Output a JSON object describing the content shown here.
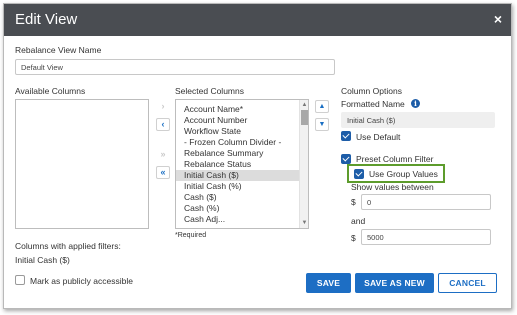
{
  "dialog": {
    "title": "Edit View",
    "close_glyph": "×"
  },
  "rebalance_view_name": {
    "label": "Rebalance View Name",
    "value": "Default View"
  },
  "available_columns": {
    "label": "Available Columns",
    "items": []
  },
  "selected_columns": {
    "label": "Selected Columns",
    "items": [
      "Account Name*",
      "Account Number",
      "Workflow State",
      "- Frozen Column Divider -",
      "Rebalance Summary",
      "Rebalance Status",
      "Initial Cash ($)",
      "Initial Cash (%)",
      "Cash ($)",
      "Cash (%)",
      "Cash Adj..."
    ],
    "selected_item": "Initial Cash ($)",
    "required_note": "*Required"
  },
  "move_buttons": {
    "add": "›",
    "remove": "‹",
    "add_all": "»",
    "remove_all": "«",
    "up": "▲",
    "down": "▼"
  },
  "column_options": {
    "label": "Column Options",
    "formatted_name_label": "Formatted Name",
    "formatted_name_value": "Initial Cash ($)",
    "info_glyph": "i",
    "use_default": {
      "label": "Use Default",
      "checked": true
    },
    "preset_column_filter": {
      "label": "Preset Column Filter",
      "checked": true
    },
    "use_group_values": {
      "label": "Use Group Values",
      "checked": true
    },
    "show_values_between_label": "Show values between",
    "and_label": "and",
    "currency_symbol": "$",
    "min_value": "0",
    "max_value": "5000"
  },
  "filters": {
    "label": "Columns with applied filters:",
    "value": "Initial Cash ($)"
  },
  "publicly_accessible": {
    "label": "Mark as publicly accessible",
    "checked": false
  },
  "buttons": {
    "save": "SAVE",
    "save_as_new": "SAVE AS NEW",
    "cancel": "CANCEL"
  },
  "colors": {
    "title_bar": "#4a4d52",
    "accent": "#1d6ec4",
    "highlight": "#5d9c2c"
  }
}
